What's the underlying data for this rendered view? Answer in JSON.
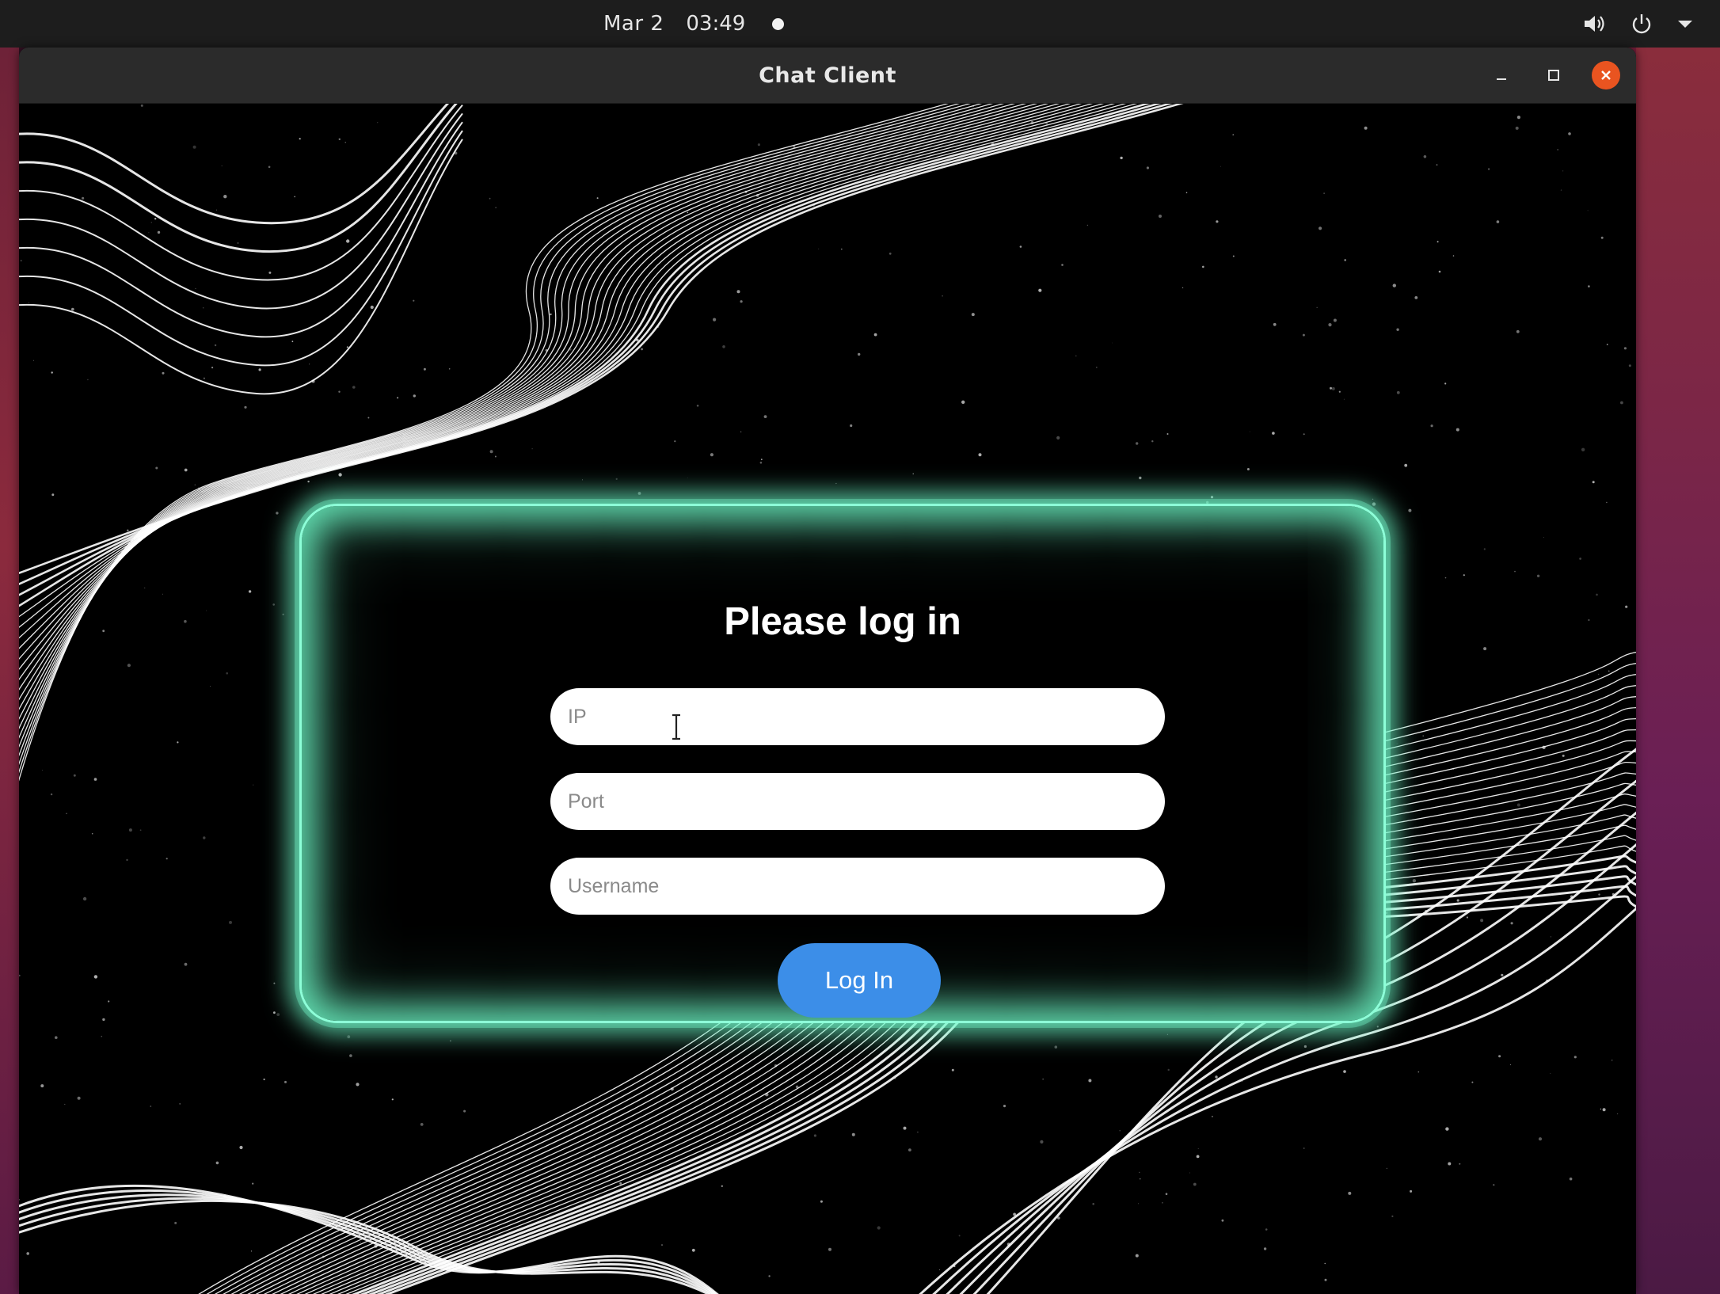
{
  "topbar": {
    "date": "Mar 2",
    "time": "03:49",
    "icons": [
      "notification-dot",
      "volume-icon",
      "power-icon",
      "chevron-down-icon"
    ]
  },
  "window": {
    "title": "Chat Client",
    "controls": [
      "minimize-icon",
      "maximize-icon",
      "close-icon"
    ]
  },
  "login": {
    "heading": "Please log in",
    "ip": {
      "value": "",
      "placeholder": "IP"
    },
    "port": {
      "value": "",
      "placeholder": "Port"
    },
    "username": {
      "value": "",
      "placeholder": "Username"
    },
    "button_label": "Log In"
  },
  "colors": {
    "glow": "#6ef8c8",
    "button": "#3c8ee8",
    "close_button": "#e95420",
    "titlebar": "#2b2b2b",
    "topbar": "#1d1d1d"
  }
}
